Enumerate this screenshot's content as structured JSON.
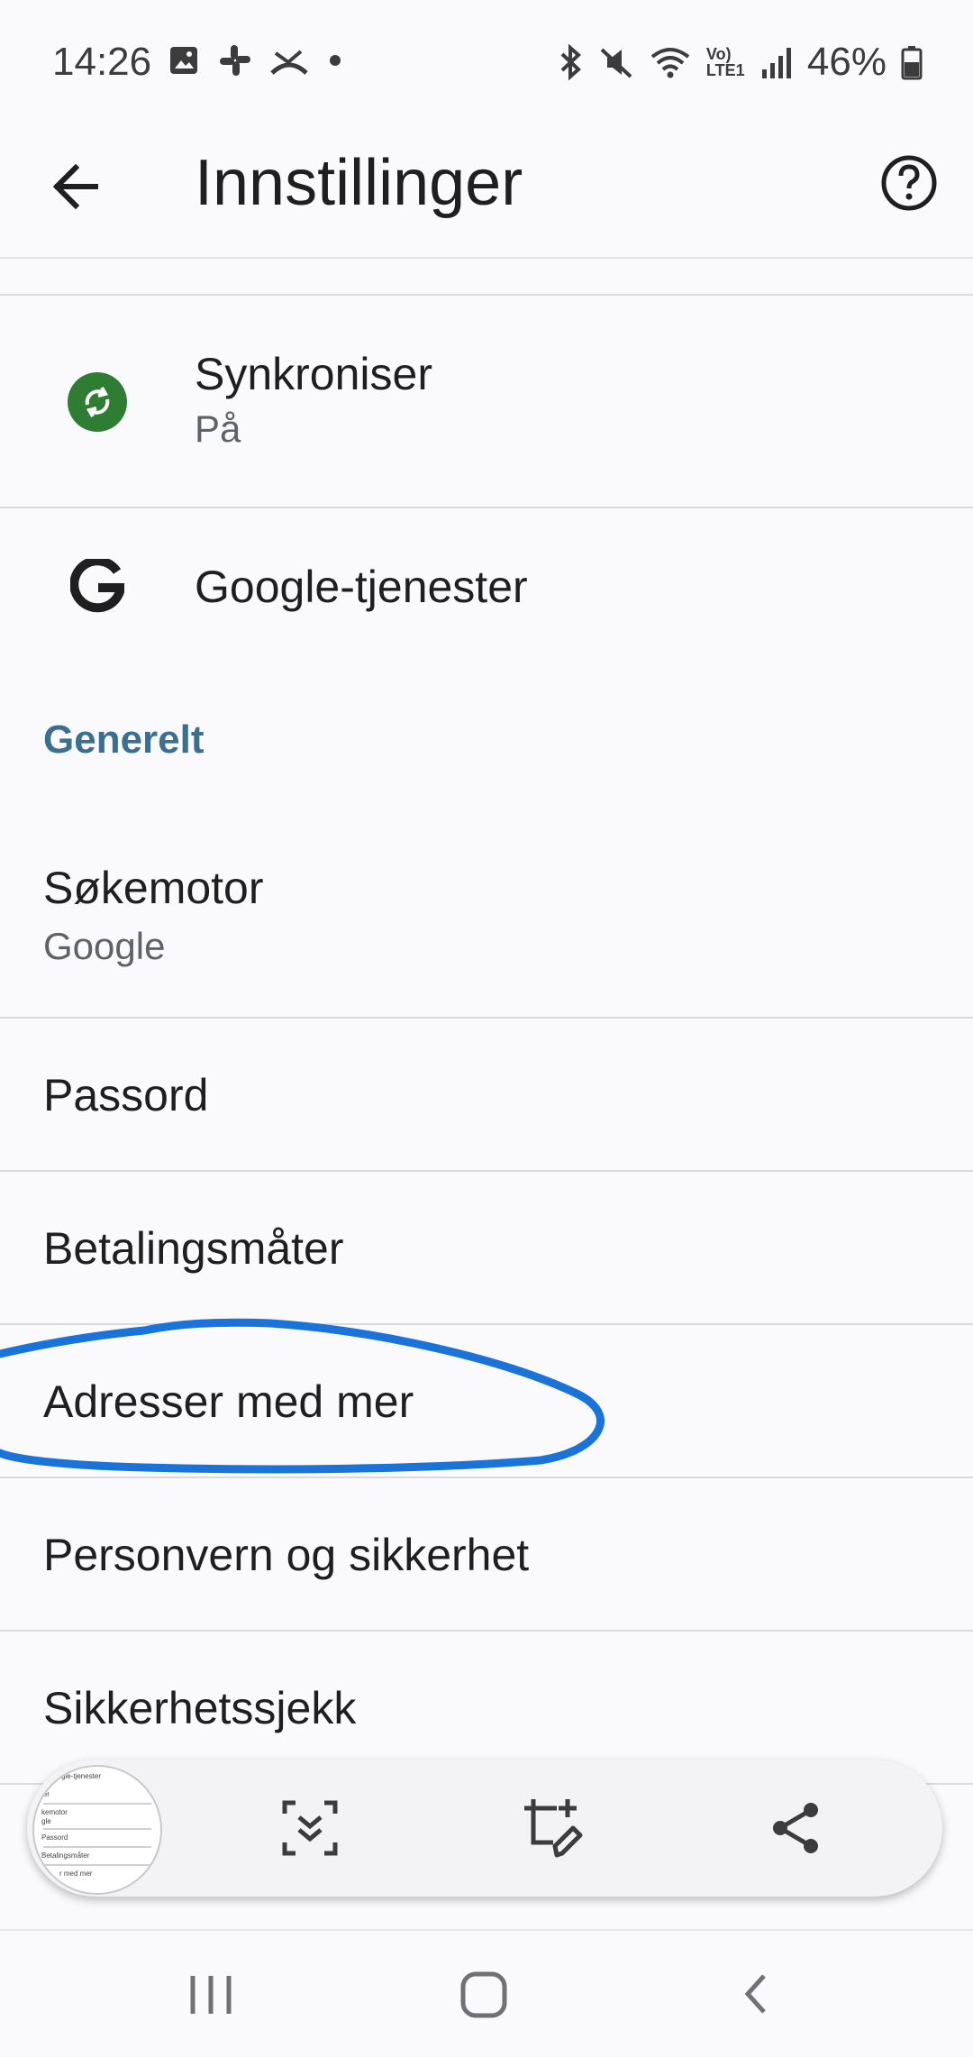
{
  "status_bar": {
    "time": "14:26",
    "battery": "46%",
    "network_label": "Vo) LTE1",
    "icons": [
      "gallery-icon",
      "slack-icon",
      "missed-call-icon",
      "notification-dot-icon",
      "bluetooth-icon",
      "mute-icon",
      "wifi-icon",
      "signal-icon",
      "battery-icon"
    ]
  },
  "app_bar": {
    "title": "Innstillinger",
    "back_icon": "arrow-back-icon",
    "help_icon": "help-circle-icon"
  },
  "account_items": [
    {
      "title": "Synkroniser",
      "subtitle": "På",
      "icon": "sync-icon"
    },
    {
      "title": "Google-tjenester",
      "icon": "google-g-icon"
    }
  ],
  "general": {
    "header": "Generelt",
    "items": [
      {
        "title": "Søkemotor",
        "subtitle": "Google"
      },
      {
        "title": "Passord"
      },
      {
        "title": "Betalingsmåter"
      },
      {
        "title": "Adresser med mer"
      },
      {
        "title": "Personvern og sikkerhet"
      },
      {
        "title": "Sikkerhetssjekk"
      }
    ]
  },
  "annotation": {
    "color": "#1a73d9",
    "shape": "hand-drawn-ellipse"
  },
  "screenshot_toolbar": {
    "thumbnail_lines": [
      "gle-tjenester",
      "ler",
      "kemotor",
      "gle",
      "Passord",
      "Betalingsmåter",
      "r med mer"
    ],
    "tools": [
      "scroll-capture-icon",
      "crop-edit-icon",
      "share-icon"
    ]
  },
  "nav_bar": {
    "buttons": [
      "recents-icon",
      "home-icon",
      "back-icon"
    ]
  },
  "colors": {
    "accent": "#3a6f8f",
    "sync_green": "#2e7d32",
    "background": "#fafafc"
  }
}
